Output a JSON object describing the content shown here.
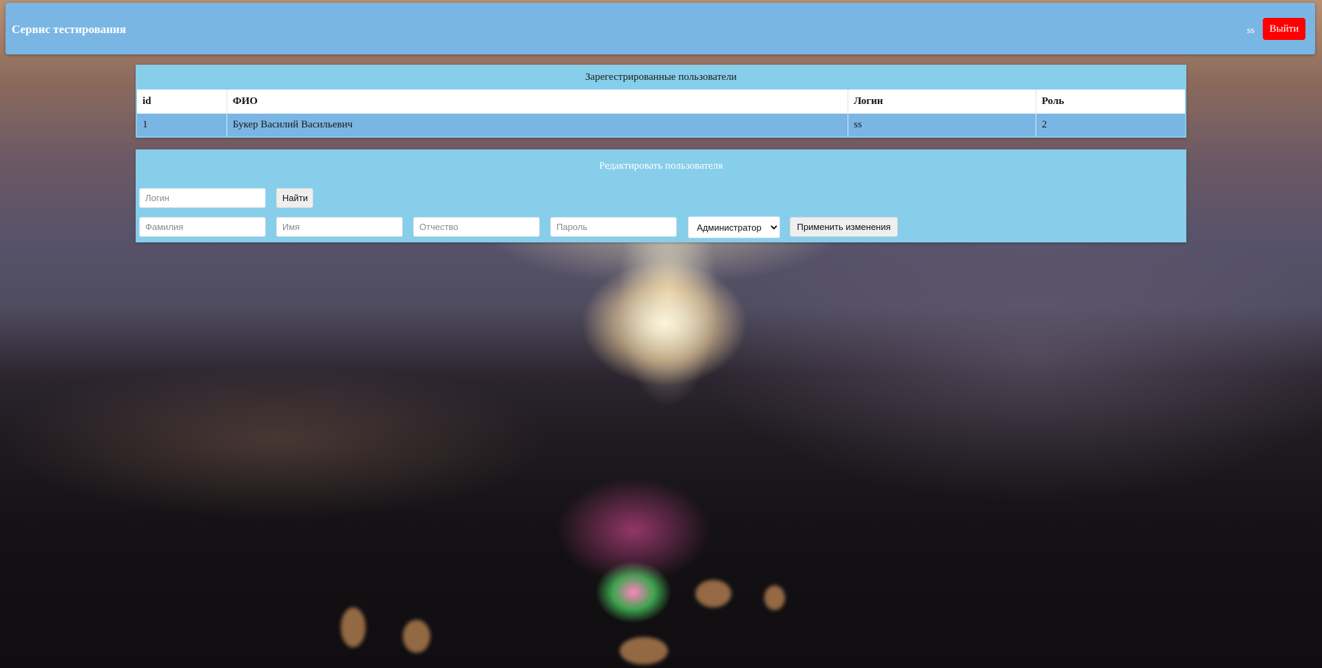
{
  "header": {
    "title": "Сервис тестирования",
    "username": "ss",
    "logout_label": "Выйти"
  },
  "users": {
    "caption": "Зарегестрированные пользователи",
    "columns": [
      "id",
      "ФИО",
      "Логин",
      "Роль"
    ],
    "rows": [
      [
        "1",
        "Букер Василий Васильевич",
        "ss",
        "2"
      ]
    ]
  },
  "edit": {
    "caption": "Редактировать пользователя",
    "login_placeholder": "Логин",
    "find_label": "Найти",
    "lastname_placeholder": "Фамилия",
    "firstname_placeholder": "Имя",
    "middlename_placeholder": "Отчество",
    "password_placeholder": "Пароль",
    "role_selected": "Администратор",
    "apply_label": "Применить изменения"
  },
  "colors": {
    "header_bg": "#7ab6e4",
    "panel_bg": "#87ceeb",
    "logout_bg": "#ff0000",
    "row_bg": "#7ab6e4"
  }
}
